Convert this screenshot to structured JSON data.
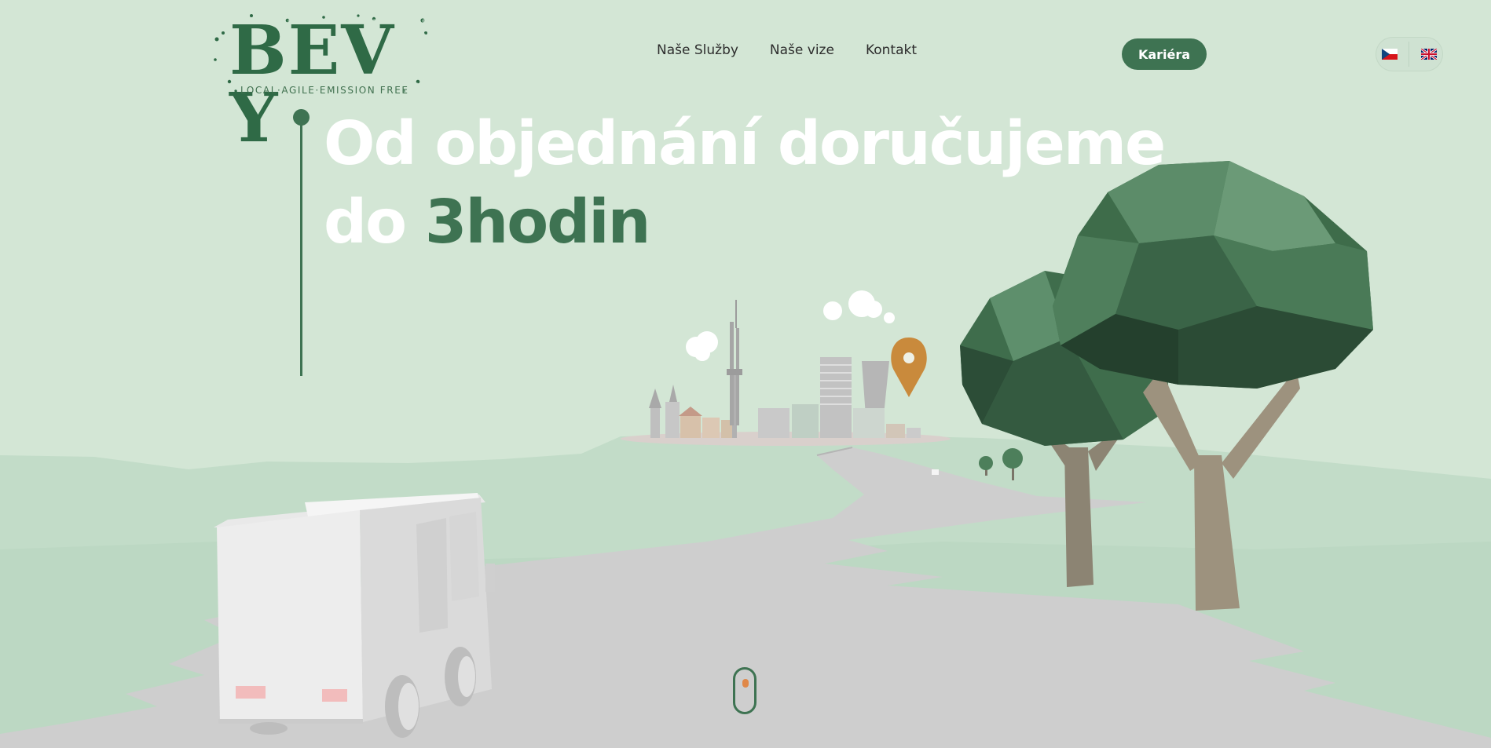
{
  "brand": {
    "letters": [
      "B",
      "E",
      "V",
      "Y"
    ],
    "tagline": "LOCAL·AGILE·EMISSION FREE"
  },
  "nav": {
    "items": [
      {
        "label": "Naše Služby"
      },
      {
        "label": "Naše vize"
      },
      {
        "label": "Kontakt"
      }
    ]
  },
  "header": {
    "career_label": "Kariéra",
    "languages": [
      {
        "code": "cs",
        "icon": "czech-flag-icon"
      },
      {
        "code": "en",
        "icon": "uk-flag-icon"
      }
    ]
  },
  "hero": {
    "title_line1": "Od objednání doručujeme",
    "title_line2_prefix": "do ",
    "title_highlight": "3hodin"
  },
  "colors": {
    "background": "#d3e6d5",
    "accent": "#3e7352",
    "road": "#cecece",
    "pin": "#c98a3c",
    "scroll_dot": "#e08848"
  }
}
